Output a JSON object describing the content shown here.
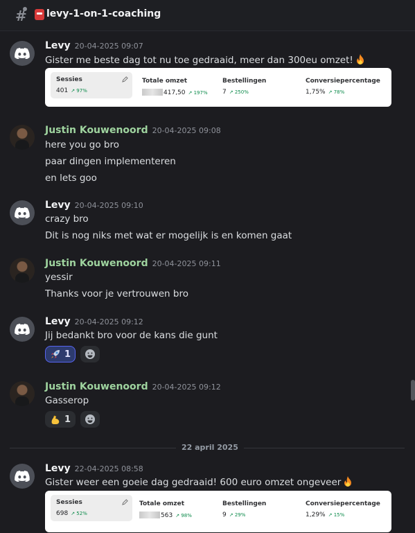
{
  "channel": {
    "name": "levy-1-on-1-coaching"
  },
  "messages": [
    {
      "author": "Levy",
      "time": "20-04-2025 09:07",
      "lines": [
        "Gister me beste dag tot nu toe gedraaid, meer dan 300eu omzet!"
      ],
      "card": {
        "sessions_label": "Sessies",
        "sessions_value": "401",
        "sessions_change": "97%",
        "revenue_label": "Totale omzet",
        "revenue_value": "417,50",
        "revenue_change": "197%",
        "orders_label": "Bestellingen",
        "orders_value": "7",
        "orders_change": "250%",
        "conv_label": "Conversiepercentage",
        "conv_value": "1,75%",
        "conv_change": "78%"
      }
    },
    {
      "author": "Justin Kouwenoord",
      "time": "20-04-2025 09:08",
      "lines": [
        "here you go bro",
        "paar dingen implementeren",
        "en lets goo"
      ]
    },
    {
      "author": "Levy",
      "time": "20-04-2025 09:10",
      "lines": [
        "crazy bro",
        "Dit is nog niks met wat er mogelijk is en komen gaat"
      ]
    },
    {
      "author": "Justin Kouwenoord",
      "time": "20-04-2025 09:11",
      "lines": [
        "yessir",
        "Thanks voor je vertrouwen bro"
      ]
    },
    {
      "author": "Levy",
      "time": "20-04-2025 09:12",
      "lines": [
        "Jij bedankt bro voor de kans die gunt"
      ],
      "reaction": {
        "emoji": "rocket",
        "count": "1"
      }
    },
    {
      "author": "Justin Kouwenoord",
      "time": "20-04-2025 09:12",
      "lines": [
        "Gasserop"
      ],
      "reaction": {
        "emoji": "flexed-biceps",
        "count": "1"
      }
    },
    {
      "author": "Levy",
      "time": "22-04-2025 08:58",
      "lines": [
        "Gister weer een goeie dag gedraaid! 600 euro omzet ongeveer"
      ],
      "card": {
        "sessions_label": "Sessies",
        "sessions_value": "698",
        "sessions_change": "52%",
        "revenue_label": "Totale omzet",
        "revenue_value": "563",
        "revenue_change": "98%",
        "orders_label": "Bestellingen",
        "orders_value": "9",
        "orders_change": "29%",
        "conv_label": "Conversiepercentage",
        "conv_value": "1,29%",
        "conv_change": "15%"
      }
    }
  ],
  "date_divider": "22 april 2025",
  "colors": {
    "background": "#1c1c20",
    "username_green": "#9fd49f",
    "discord_blurple": "#5865f2"
  }
}
